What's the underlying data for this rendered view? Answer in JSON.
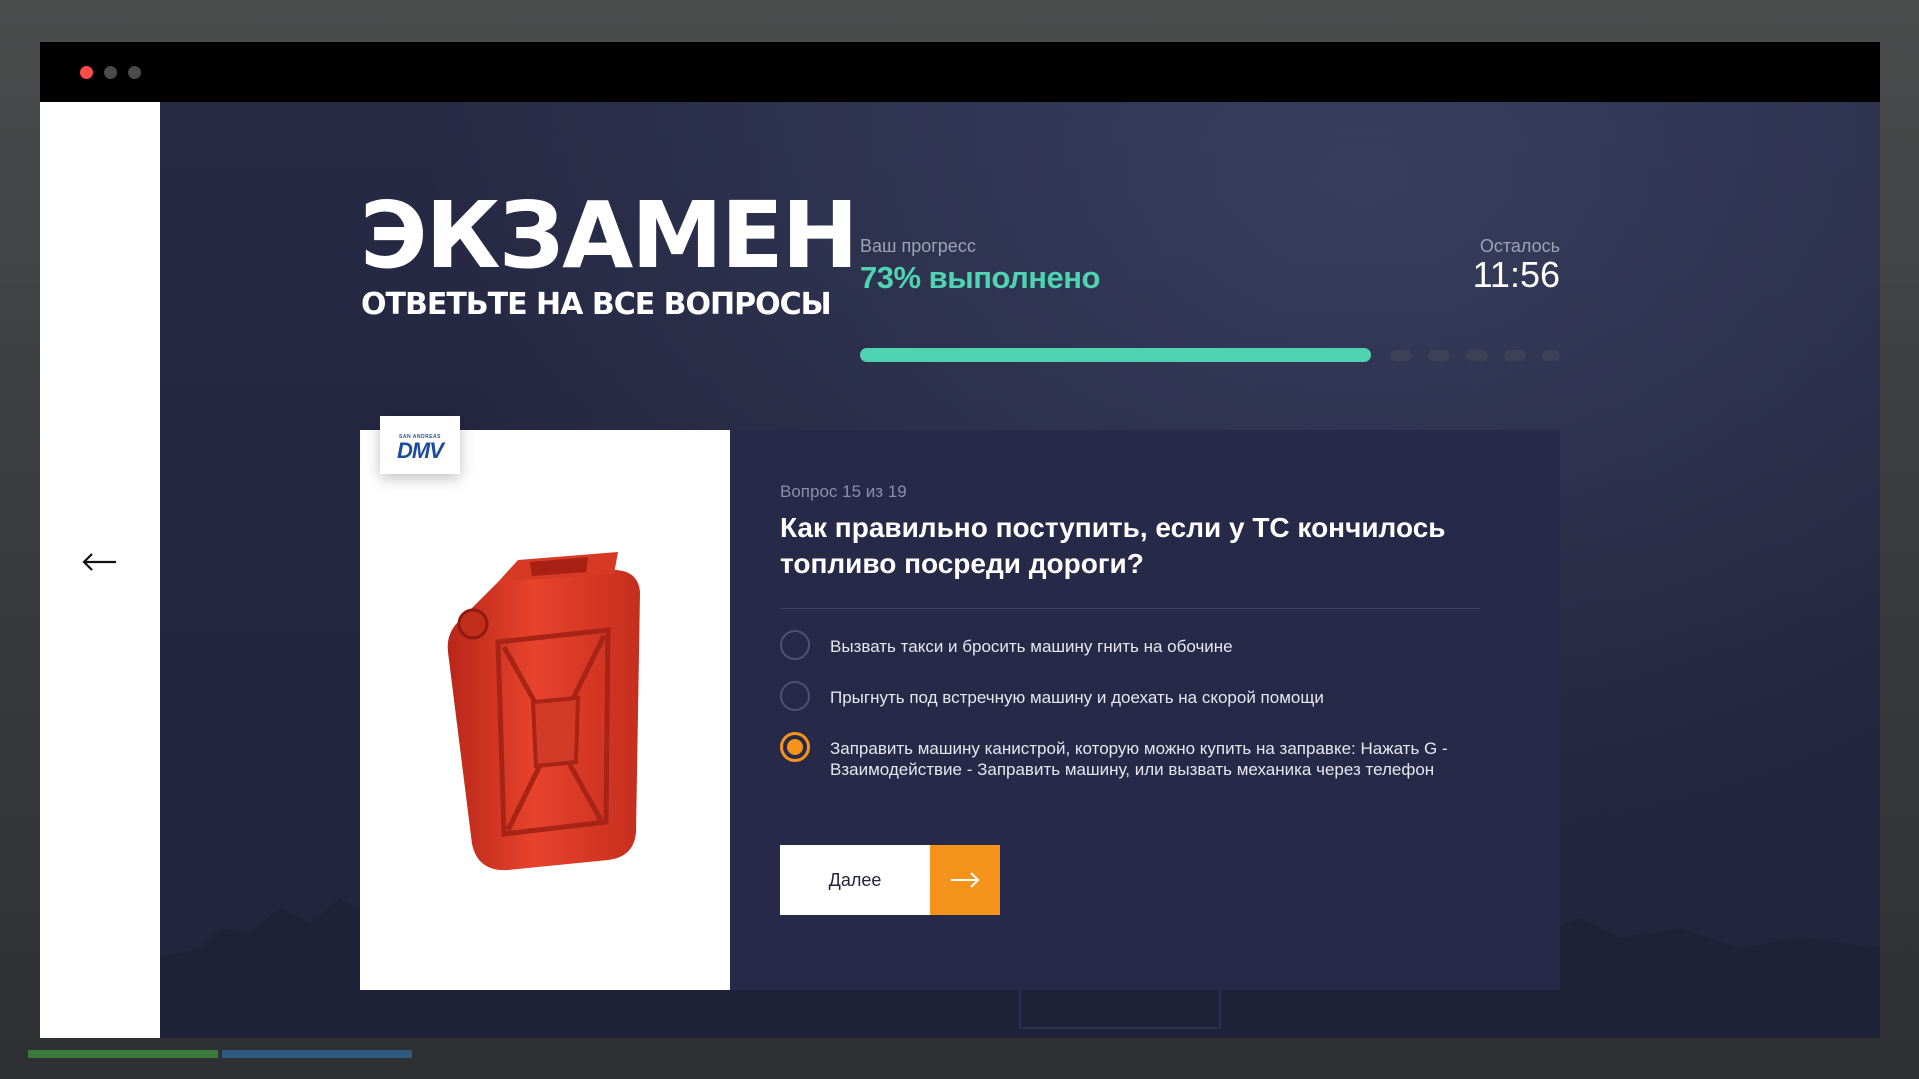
{
  "header": {
    "title": "ЭКЗАМЕН",
    "subtitle": "ОТВЕТЬТЕ НА ВСЕ ВОПРОСЫ"
  },
  "progress": {
    "label": "Ваш прогресс",
    "value_text": "73% выполнено",
    "fraction": 0.73
  },
  "timer": {
    "label": "Осталось",
    "value": "11:56"
  },
  "question": {
    "counter": "Вопрос 15 из 19",
    "text": "Как правильно поступить, если у ТС кончилось топливо посреди дороги?",
    "options": [
      {
        "label": "Вызвать такси и бросить машину гнить на обочине",
        "selected": false
      },
      {
        "label": "Прыгнуть под встречную машину и доехать на скорой помощи",
        "selected": false
      },
      {
        "label": "Заправить машину канистрой, которую можно купить на заправке: Нажать G - Взаимодействие - Заправить машину, или вызвать механика через телефон",
        "selected": true
      }
    ]
  },
  "next_button": {
    "label": "Далее"
  },
  "badge": {
    "top_text": "SAN ANDREAS",
    "main_text": "DMV"
  },
  "colors": {
    "accent_orange": "#f6931d",
    "progress_green": "#4fd3b0",
    "panel_bg": "#262a48",
    "page_bg": "#22253e"
  },
  "icons": {
    "back": "arrow-left-icon",
    "next": "arrow-right-icon",
    "image": "fuel-canister-icon"
  }
}
